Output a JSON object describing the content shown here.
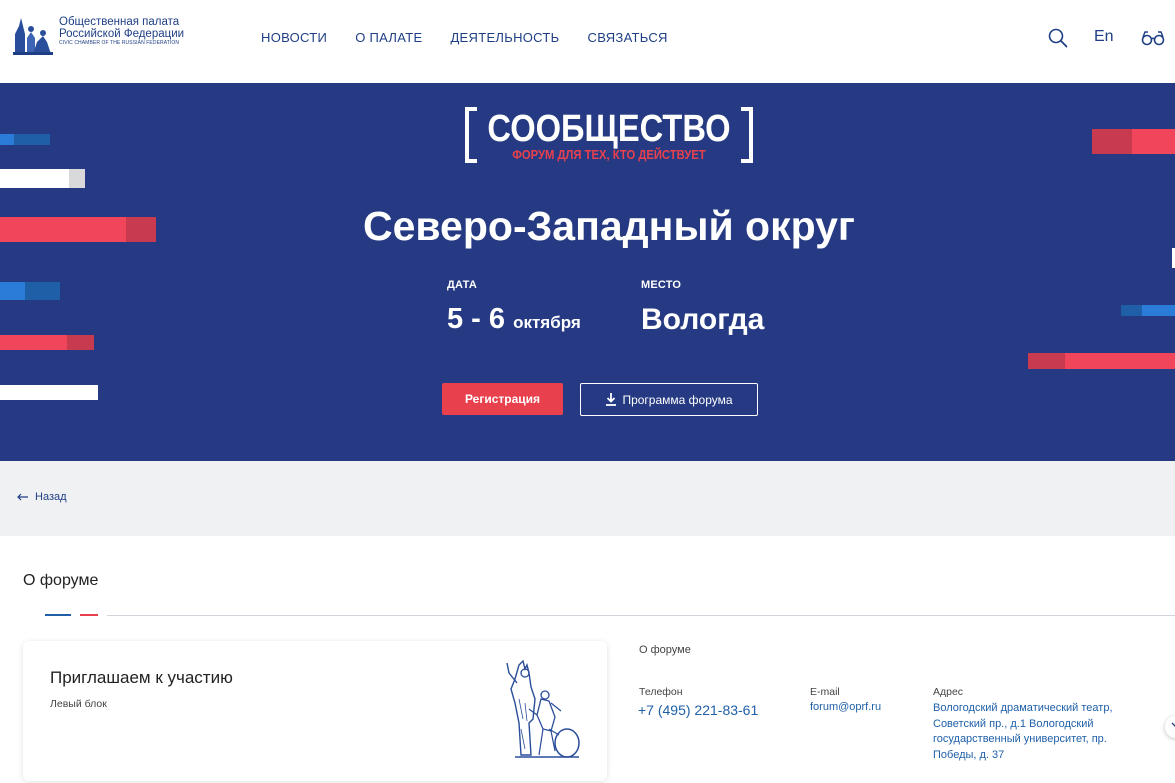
{
  "header": {
    "logo": {
      "line1": "Общественная палата",
      "line2": "Российской Федерации",
      "line3": "CIVIC CHAMBER OF THE RUSSIAN FEDERATION"
    },
    "nav": [
      "НОВОСТИ",
      "О ПАЛАТЕ",
      "ДЕЯТЕЛЬНОСТЬ",
      "СВЯЗАТЬСЯ"
    ],
    "lang": "En",
    "icons": [
      "search-icon",
      "glasses-icon"
    ]
  },
  "banner": {
    "brand_title": "СООБЩЕСТВО",
    "brand_sub": "ФОРУМ ДЛЯ ТЕХ, КТО ДЕЙСТВУЕТ",
    "title": "Северо-Западный округ",
    "date_label": "ДАТА",
    "date_days": "5 - 6",
    "date_month": "октября",
    "place_label": "МЕСТО",
    "place": "Вологда",
    "register_button": "Регистрация",
    "program_button": "Программа форума",
    "colors": {
      "background": "#253a82",
      "accent_red": "#e8404d",
      "accent_blue": "#1f5fa8"
    }
  },
  "back": {
    "label": "Назад"
  },
  "section": {
    "title": "О форуме",
    "card": {
      "title": "Приглашаем к участию",
      "subtitle": "Левый блок"
    },
    "about_label": "О форуме",
    "contacts": {
      "phone_label": "Телефон",
      "phone": "+7 (495) 221-83-61",
      "email_label": "E-mail",
      "email": "forum@oprf.ru",
      "address_label": "Адрес",
      "address": "Вологодский драматический театр, Советский пр., д.1 Вологодский государственный университет, пр. Победы, д. 37"
    }
  }
}
